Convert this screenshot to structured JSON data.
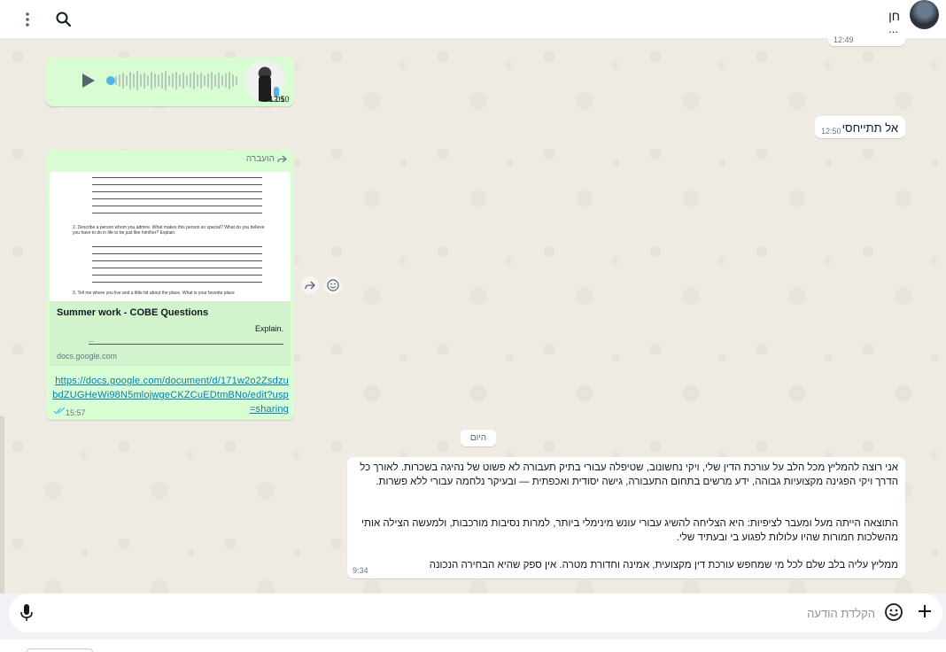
{
  "header": {
    "contact_name": "חן",
    "icons": [
      "menu-icon",
      "search-icon",
      "avatar"
    ]
  },
  "messages": {
    "truncated": {
      "text": "...",
      "time": "12:49"
    },
    "voice": {
      "duration": "0:01",
      "time": "12:50"
    },
    "short_in": {
      "text": "אל תתייחסי",
      "time": "12:50"
    },
    "forwarded": {
      "label": "הועברה",
      "doc_lines": [
        "2. Describe a person whom you admire. What makes this person so special? What do you believe you have to do in life to be just like him/her? Explain.",
        "3. Tell me where you live and a little bit about the place. What is your favorite place"
      ],
      "card_title": "Summer work - COBE Questions",
      "card_desc": "Explain.",
      "card_dots": "...",
      "card_domain": "docs.google.com",
      "url": "https://docs.google.com/document/d/171w2o2ZsdzubdZUGHeWi98N5mlojwgeCKZCuEDtmBNo/edit?usp=sharing",
      "time": "15:57"
    },
    "date_chip": "היום",
    "long": {
      "p1": "אני רוצה להמליץ מכל הלב על עורכת הדין שלי, ויקי נחשונוב, שטיפלה עבורי בתיק תעבורה לא פשוט של נהיגה בשכרות. לאורך כל הדרך ויקי הפגינה מקצועיות גבוהה, ידע מרשים בתחום התעבורה, גישה יסודית ואכפתית — ובעיקר נלחמה עבורי ללא פשרות.",
      "p2": "התוצאה הייתה מעל ומעבר לציפיות: היא הצליחה להשיג עבורי עונש מינימלי ביותר, למרות נסיבות מורכבות, ולמעשה הצילה אותי מהשלכות חמורות שהיו עלולות לפגוע בי ובעתיד שלי.",
      "p3": "ממליץ עליה בלב שלם לכל מי שמחפש עורכת דין מקצועית, אמינה וחדורת מטרה. אין ספק שהיא הבחירה הנכונה",
      "time": "9:34"
    }
  },
  "composer": {
    "placeholder": "הקלדת הודעה"
  },
  "colors": {
    "outgoing": "#d9fdd3",
    "incoming": "#ffffff",
    "background": "#efeae2",
    "link": "#027eb5",
    "read_ticks": "#53bdeb"
  }
}
